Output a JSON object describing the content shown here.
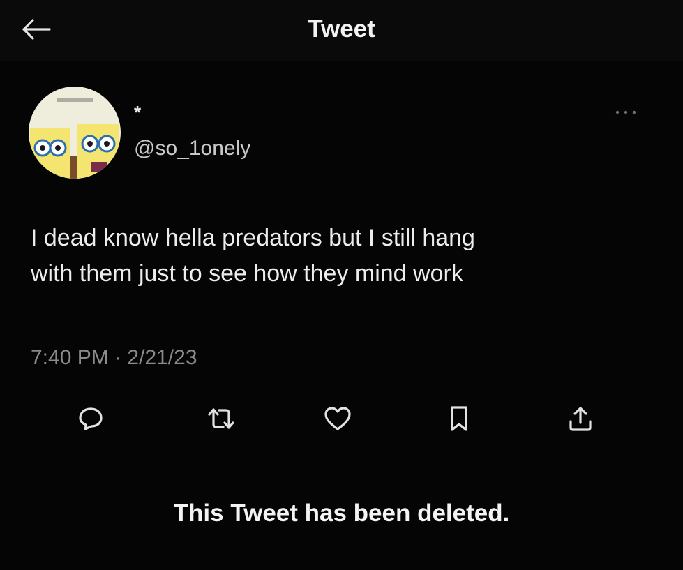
{
  "header": {
    "title": "Tweet",
    "back_icon": "arrow-left-icon"
  },
  "author": {
    "display_name": "*",
    "handle": "@so_1onely",
    "avatar_icon": "spongebob-avatar"
  },
  "tweet": {
    "text_lines": [
      "I dead know hella predators but I still hang",
      "with them just to see how they mind work"
    ],
    "time": "7:40 PM",
    "separator": "·",
    "date": "2/21/23"
  },
  "actions": [
    {
      "icon": "reply-icon"
    },
    {
      "icon": "retweet-icon"
    },
    {
      "icon": "like-icon"
    },
    {
      "icon": "bookmark-icon"
    },
    {
      "icon": "share-icon"
    }
  ],
  "notice": "This Tweet has been deleted.",
  "colors": {
    "background": "#050505",
    "text": "#e7e9ea",
    "secondary_text": "#8b8b8b"
  }
}
